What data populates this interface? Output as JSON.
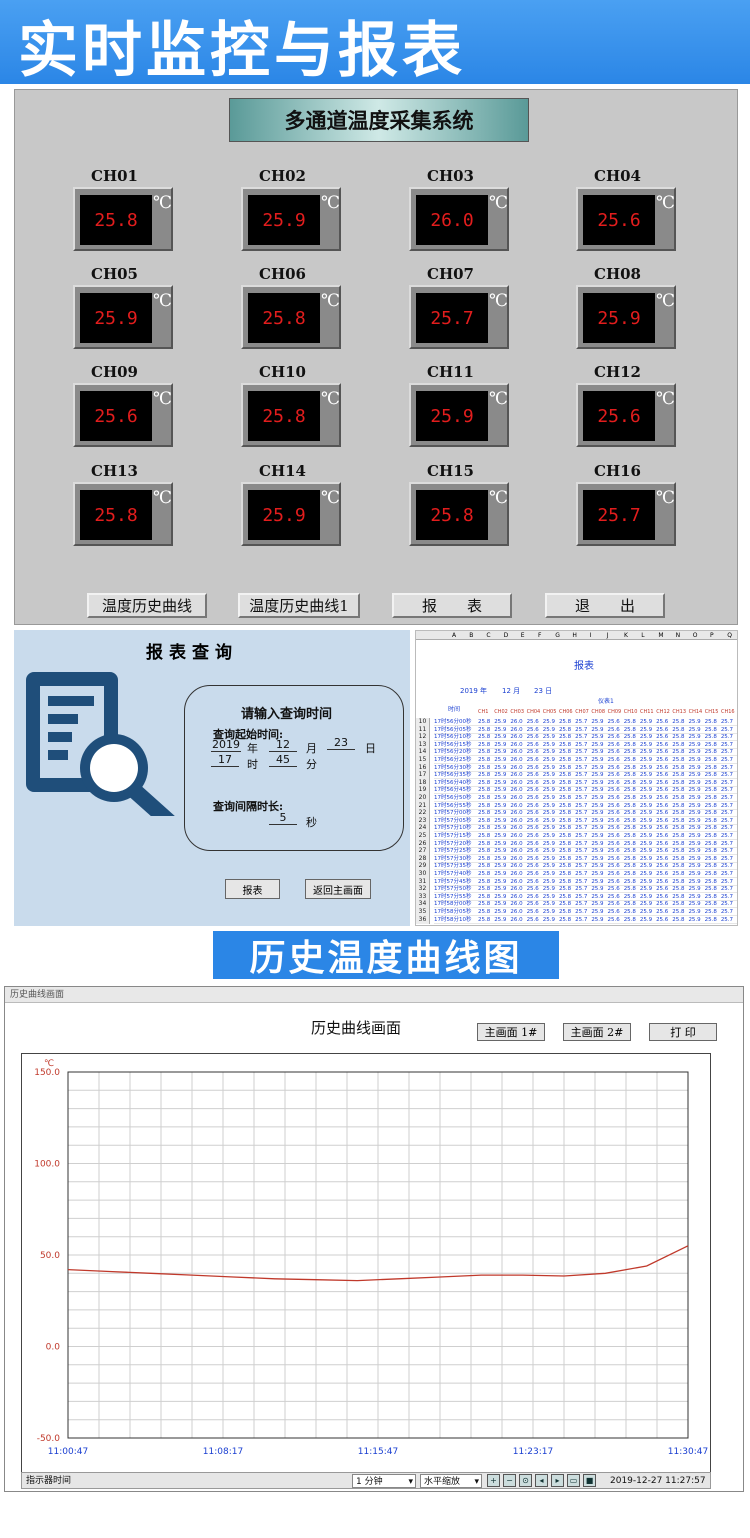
{
  "banner": {
    "title": "实时监控与报表"
  },
  "scada": {
    "title": "多通道温度采集系统",
    "unit": "℃",
    "channels": [
      {
        "name": "CH01",
        "value": "25.8"
      },
      {
        "name": "CH02",
        "value": "25.9"
      },
      {
        "name": "CH03",
        "value": "26.0"
      },
      {
        "name": "CH04",
        "value": "25.6"
      },
      {
        "name": "CH05",
        "value": "25.9"
      },
      {
        "name": "CH06",
        "value": "25.8"
      },
      {
        "name": "CH07",
        "value": "25.7"
      },
      {
        "name": "CH08",
        "value": "25.9"
      },
      {
        "name": "CH09",
        "value": "25.6"
      },
      {
        "name": "CH10",
        "value": "25.8"
      },
      {
        "name": "CH11",
        "value": "25.9"
      },
      {
        "name": "CH12",
        "value": "25.6"
      },
      {
        "name": "CH13",
        "value": "25.8"
      },
      {
        "name": "CH14",
        "value": "25.9"
      },
      {
        "name": "CH15",
        "value": "25.8"
      },
      {
        "name": "CH16",
        "value": "25.7"
      }
    ],
    "buttons": [
      "温度历史曲线",
      "温度历史曲线1",
      "报　　表",
      "退　　出"
    ]
  },
  "query": {
    "title": "报表查询",
    "box_title": "请输入查询时间",
    "start_label": "查询起始时间:",
    "year": "2019",
    "year_unit": "年",
    "month": "12",
    "month_unit": "月",
    "day": "23",
    "day_unit": "日",
    "hour": "17",
    "hour_unit": "时",
    "minute": "45",
    "minute_unit": "分",
    "interval_label": "查询间隔时长:",
    "interval": "5",
    "interval_unit": "秒",
    "btn_report": "报表",
    "btn_back": "返回主画面"
  },
  "sheet": {
    "title": "报表",
    "year": "2019 年",
    "month": "12 月",
    "day": "23 日",
    "group": "仪表1",
    "time_header": "时间",
    "col_letters": [
      "A",
      "B",
      "C",
      "D",
      "E",
      "F",
      "G",
      "H",
      "I",
      "J",
      "K",
      "L",
      "M",
      "N",
      "O",
      "P",
      "Q"
    ],
    "channels": [
      "CH1",
      "CH02",
      "CH03",
      "CH04",
      "CH05",
      "CH06",
      "CH07",
      "CH08",
      "CH09",
      "CH10",
      "CH11",
      "CH12",
      "CH13",
      "CH14",
      "CH15",
      "CH16"
    ],
    "row_values": [
      "25.8",
      "25.9",
      "26.0",
      "25.6",
      "25.9",
      "25.8",
      "25.7",
      "25.9",
      "25.6",
      "25.8",
      "25.9",
      "25.6",
      "25.8",
      "25.9",
      "25.8",
      "25.7"
    ],
    "row_times": [
      "17时56分00秒",
      "17时56分05秒",
      "17时56分10秒",
      "17时56分15秒",
      "17时56分20秒",
      "17时56分25秒",
      "17时56分30秒",
      "17时56分35秒",
      "17时56分40秒",
      "17时56分45秒",
      "17时56分50秒",
      "17时56分55秒",
      "17时57分00秒",
      "17时57分05秒",
      "17时57分10秒",
      "17时57分15秒",
      "17时57分20秒",
      "17时57分25秒",
      "17时57分30秒",
      "17时57分35秒",
      "17时57分40秒",
      "17时57分45秒",
      "17时57分50秒",
      "17时57分55秒",
      "17时58分00秒",
      "17时58分05秒",
      "17时58分10秒"
    ]
  },
  "history_banner": {
    "title": "历史温度曲线图"
  },
  "history": {
    "window_title": "历史曲线画面",
    "heading": "历史曲线画面",
    "btn_main1": "主画面 1#",
    "btn_main2": "主画面 2#",
    "btn_print": "打 印",
    "status_label": "指示器时间",
    "interval_select": "1 分钟",
    "zoom_select": "水平缩放",
    "timestamp": "2019-12-27 11:27:57"
  },
  "chart_data": {
    "type": "line",
    "title": "",
    "ylabel": "℃",
    "xlabel": "",
    "ylim": [
      -50,
      150
    ],
    "yticks": [
      "150.0",
      "100.0",
      "50.0",
      "0.0",
      "-50.0"
    ],
    "ytick_values": [
      150,
      100,
      50,
      0,
      -50
    ],
    "xticks": [
      "11:00:47",
      "11:08:17",
      "11:15:47",
      "11:23:17",
      "11:30:47"
    ],
    "grid": true,
    "series": [
      {
        "color": "#c0392b",
        "x_minutes": [
          0,
          2,
          4,
          6,
          8,
          10,
          12,
          14,
          16,
          18,
          20,
          22,
          24,
          26,
          28,
          30
        ],
        "values": [
          42,
          41,
          40,
          39,
          38,
          37,
          36.5,
          36,
          37,
          38,
          39,
          39,
          38.5,
          40,
          44,
          55
        ]
      }
    ]
  }
}
